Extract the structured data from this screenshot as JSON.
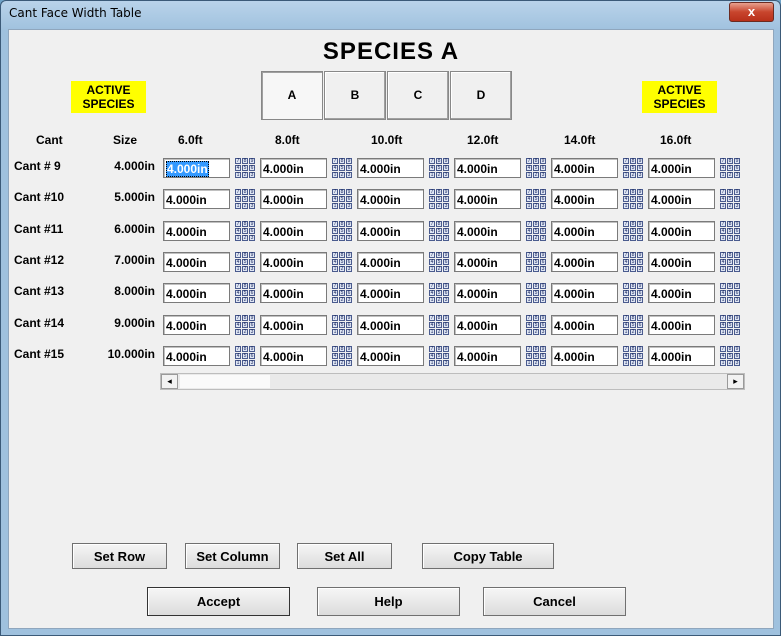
{
  "window": {
    "title": "Cant Face Width Table",
    "close_label": "x"
  },
  "species_title": "SPECIES A",
  "active_species_left": "ACTIVE SPECIES",
  "active_species_right": "ACTIVE SPECIES",
  "tabs": [
    {
      "label": "A",
      "selected": true
    },
    {
      "label": "B",
      "selected": false
    },
    {
      "label": "C",
      "selected": false
    },
    {
      "label": "D",
      "selected": false
    }
  ],
  "headers": {
    "cant": "Cant",
    "size": "Size"
  },
  "columns": [
    "6.0ft",
    "8.0ft",
    "10.0ft",
    "12.0ft",
    "14.0ft",
    "16.0ft"
  ],
  "rows": [
    {
      "cant": "Cant # 9",
      "size": "4.000in"
    },
    {
      "cant": "Cant #10",
      "size": "5.000in"
    },
    {
      "cant": "Cant #11",
      "size": "6.000in"
    },
    {
      "cant": "Cant #12",
      "size": "7.000in"
    },
    {
      "cant": "Cant #13",
      "size": "8.000in"
    },
    {
      "cant": "Cant #14",
      "size": "9.000in"
    },
    {
      "cant": "Cant #15",
      "size": "10.000in"
    }
  ],
  "cell_value": "4.000in",
  "keypad_digits": [
    "7",
    "8",
    "9",
    "4",
    "5",
    "6",
    "1",
    "2",
    "3"
  ],
  "scroll": {
    "left": "◂",
    "right": "▸"
  },
  "buttons": {
    "set_row": "Set Row",
    "set_column": "Set Column",
    "set_all": "Set All",
    "copy_table": "Copy Table",
    "accept": "Accept",
    "help": "Help",
    "cancel": "Cancel"
  }
}
